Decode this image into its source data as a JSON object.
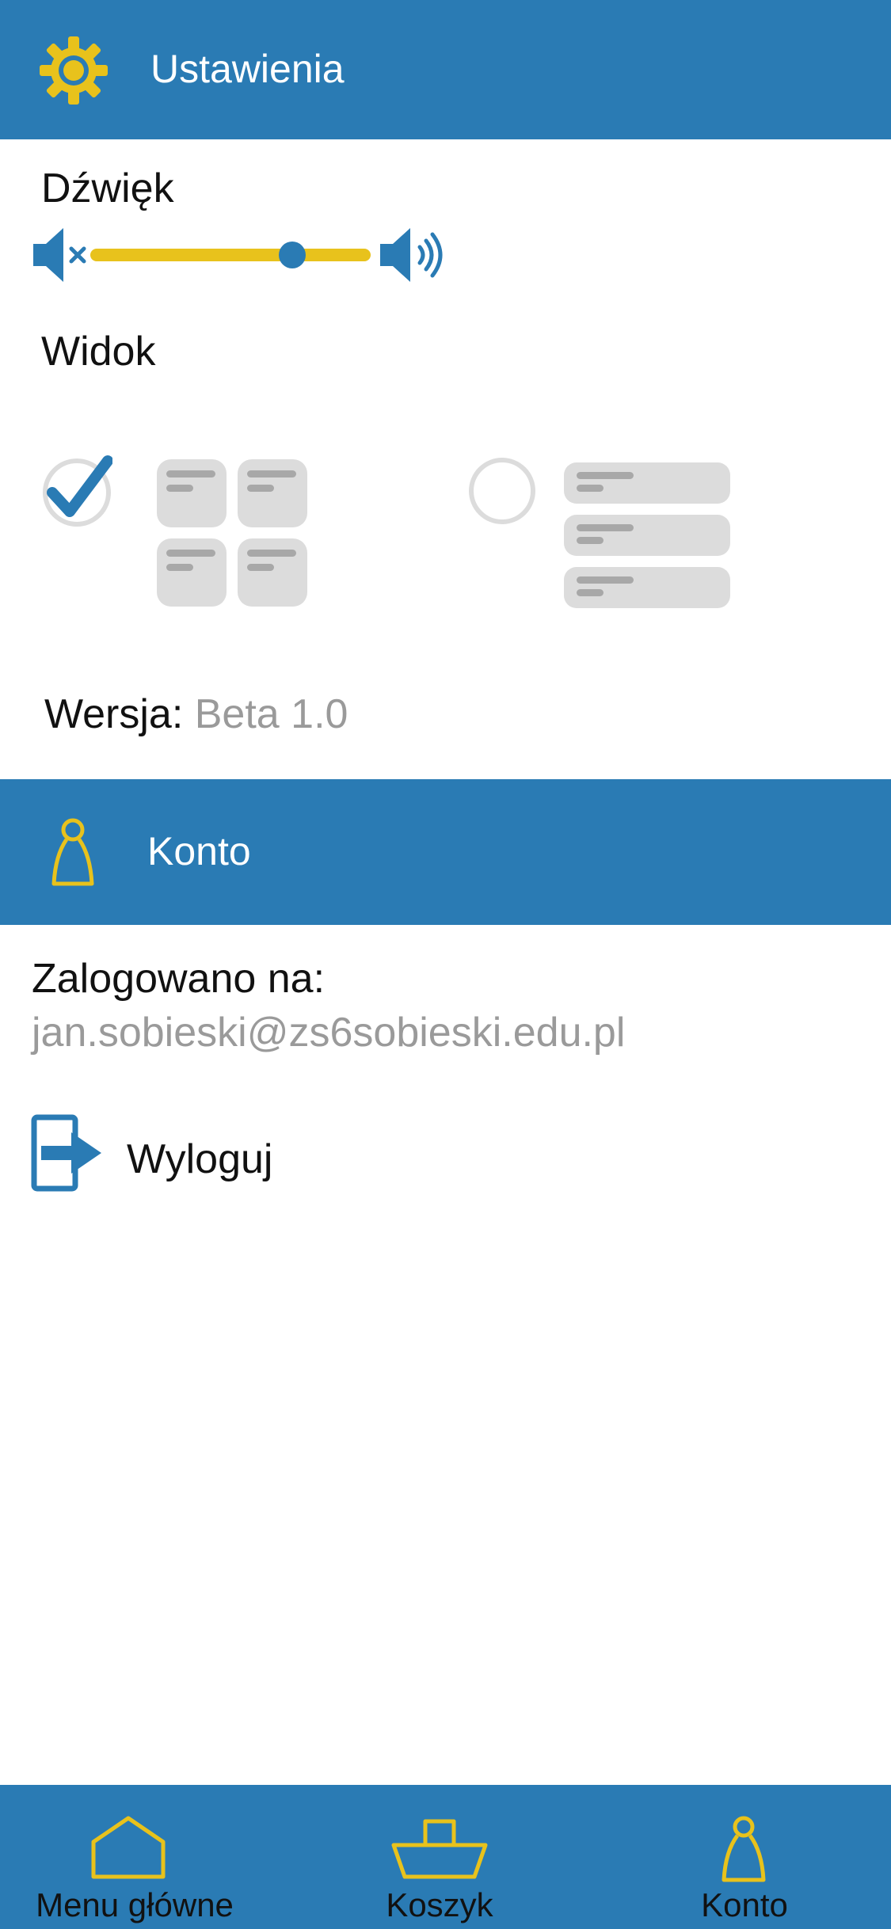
{
  "colors": {
    "primary": "#2a7bb4",
    "accent": "#e8c21c",
    "tile": "#dcdcdc",
    "muted": "#9a9a9a"
  },
  "settings": {
    "title": "Ustawienia",
    "icon": "gear-icon",
    "sound": {
      "label": "Dźwięk",
      "volume_percent": 72
    },
    "view": {
      "label": "Widok",
      "options": [
        {
          "name": "grid",
          "selected": true
        },
        {
          "name": "list",
          "selected": false
        }
      ]
    },
    "version": {
      "label": "Wersja:",
      "value": "Beta 1.0"
    }
  },
  "account": {
    "title": "Konto",
    "icon": "person-icon",
    "logged_in_label": "Zalogowano na:",
    "email": "jan.sobieski@zs6sobieski.edu.pl",
    "logout_label": "Wyloguj"
  },
  "bottom_nav": {
    "items": [
      {
        "label": "Menu główne",
        "icon": "home-icon"
      },
      {
        "label": "Koszyk",
        "icon": "basket-icon"
      },
      {
        "label": "Konto",
        "icon": "person-icon"
      }
    ]
  }
}
